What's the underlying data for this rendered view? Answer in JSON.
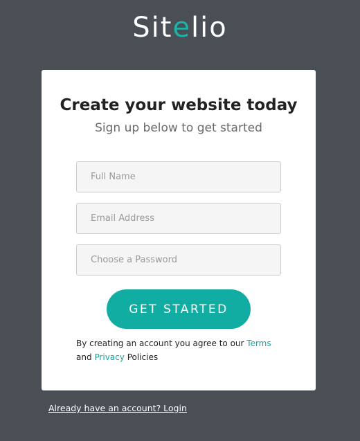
{
  "brand": {
    "logo_prefix": "Sit",
    "logo_accent": "e",
    "logo_suffix": "lio",
    "accent_color": "#1ab3a8"
  },
  "card": {
    "title": "Create your website today",
    "subtitle": "Sign up below to get started"
  },
  "form": {
    "full_name_placeholder": "Full Name",
    "email_placeholder": "Email Address",
    "password_placeholder": "Choose a Password",
    "submit_label": "GET STARTED"
  },
  "terms": {
    "prefix": "By creating an account you agree to our",
    "terms_link": "Terms",
    "conjunction": "and",
    "privacy_link": "Privacy",
    "suffix": "Policies"
  },
  "footer": {
    "login_text": "Already have an account? Login"
  },
  "colors": {
    "background": "#4a4e55",
    "button": "#12ada2",
    "link": "#14a89d"
  }
}
